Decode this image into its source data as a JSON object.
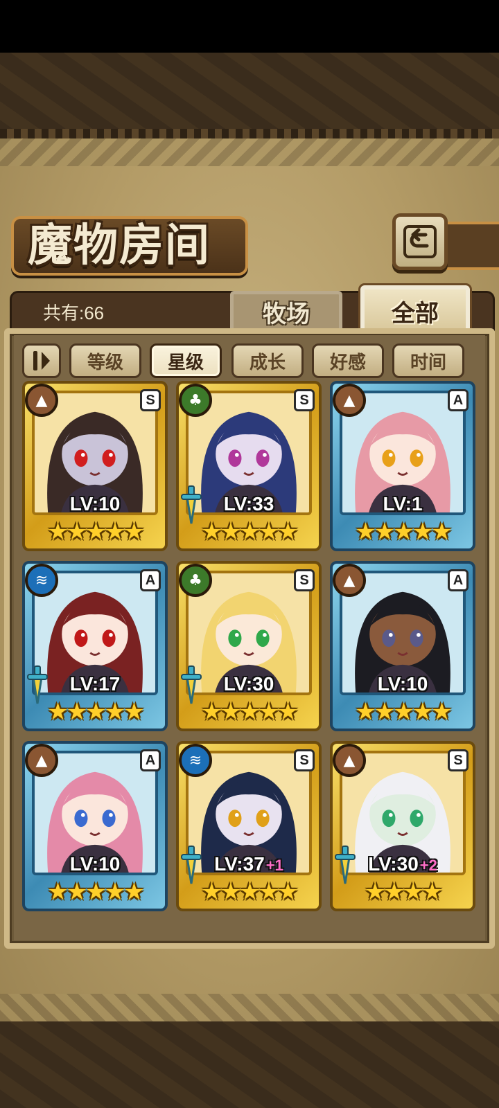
{
  "title": "魔物房间",
  "count_label": "共有:66",
  "tabs": [
    {
      "label": "牧场",
      "active": false
    },
    {
      "label": "全部",
      "active": true
    }
  ],
  "sort_buttons": [
    {
      "label": "等级",
      "active": false
    },
    {
      "label": "星级",
      "active": true
    },
    {
      "label": "成长",
      "active": false
    },
    {
      "label": "好感",
      "active": false
    },
    {
      "label": "时间",
      "active": false
    }
  ],
  "icons": {
    "back": "back-return-icon",
    "sort_toggle": "sort-order-icon"
  },
  "colors": {
    "gold_frame": "#e8b82a",
    "blue_frame": "#4f9fc6",
    "earth": "#8a5632",
    "wood": "#3c7a2a",
    "water": "#1c6fb8",
    "plus": "#ff6ec8"
  },
  "monsters": [
    {
      "frame": "gold",
      "element": "earth",
      "rank": "S",
      "weapon": false,
      "level": "LV:10",
      "plus": "",
      "stars": 5,
      "hair": "#3a2a26",
      "skin": "#c9c3d8",
      "eye": "#d11e1e"
    },
    {
      "frame": "gold",
      "element": "wood",
      "rank": "S",
      "weapon": true,
      "level": "LV:33",
      "plus": "",
      "stars": 5,
      "hair": "#2c3a7a",
      "skin": "#e6dcef",
      "eye": "#b0389a"
    },
    {
      "frame": "blue",
      "element": "earth",
      "rank": "A",
      "weapon": false,
      "level": "LV:1",
      "plus": "",
      "stars": 5,
      "hair": "#e79aa6",
      "skin": "#fbe6dc",
      "eye": "#e8a019"
    },
    {
      "frame": "blue",
      "element": "water",
      "rank": "A",
      "weapon": true,
      "level": "LV:17",
      "plus": "",
      "stars": 5,
      "hair": "#7a2222",
      "skin": "#fbe6dc",
      "eye": "#c01818"
    },
    {
      "frame": "gold",
      "element": "wood",
      "rank": "S",
      "weapon": true,
      "level": "LV:30",
      "plus": "",
      "stars": 5,
      "hair": "#f2d470",
      "skin": "#fbe9d8",
      "eye": "#2fa84a"
    },
    {
      "frame": "blue",
      "element": "earth",
      "rank": "A",
      "weapon": false,
      "level": "LV:10",
      "plus": "",
      "stars": 5,
      "hair": "#1c1c22",
      "skin": "#8a5a3c",
      "eye": "#5a5a8a"
    },
    {
      "frame": "blue",
      "element": "earth",
      "rank": "A",
      "weapon": false,
      "level": "LV:10",
      "plus": "",
      "stars": 5,
      "hair": "#e48aa8",
      "skin": "#fbe6dc",
      "eye": "#3a6ad0"
    },
    {
      "frame": "gold",
      "element": "water",
      "rank": "S",
      "weapon": true,
      "level": "LV:37",
      "plus": "+1",
      "stars": 5,
      "hair": "#1e2a4a",
      "skin": "#e8e2f0",
      "eye": "#e0a018"
    },
    {
      "frame": "gold",
      "element": "earth",
      "rank": "S",
      "weapon": true,
      "level": "LV:30",
      "plus": "+2",
      "stars": 4,
      "hair": "#f0f0f4",
      "skin": "#dfeee0",
      "eye": "#2fa86a"
    }
  ]
}
